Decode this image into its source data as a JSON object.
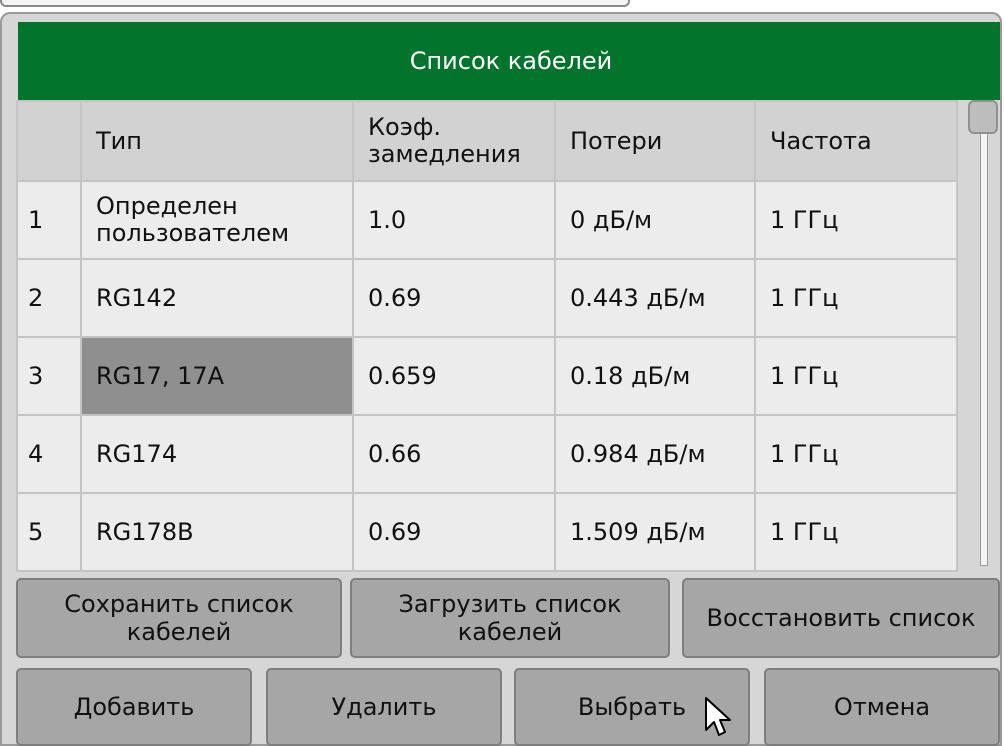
{
  "dialog": {
    "title": "Список кабелей"
  },
  "table": {
    "headers": [
      "",
      "Тип",
      "Коэф.\nзамедления",
      "Потери",
      "Частота"
    ],
    "rows": [
      {
        "n": "1",
        "type": "Определен\nпользователем",
        "vf": "1.0",
        "loss": "0 дБ/м",
        "freq": "1 ГГц"
      },
      {
        "n": "2",
        "type": "RG142",
        "vf": "0.69",
        "loss": "0.443 дБ/м",
        "freq": "1 ГГц"
      },
      {
        "n": "3",
        "type": "RG17, 17A",
        "vf": "0.659",
        "loss": "0.18 дБ/м",
        "freq": "1 ГГц"
      },
      {
        "n": "4",
        "type": "RG174",
        "vf": "0.66",
        "loss": "0.984 дБ/м",
        "freq": "1 ГГц"
      },
      {
        "n": "5",
        "type": "RG178B",
        "vf": "0.69",
        "loss": "1.509 дБ/м",
        "freq": "1 ГГц"
      }
    ],
    "selected_row": 3
  },
  "buttons": {
    "save_list": "Сохранить список\nкабелей",
    "load_list": "Загрузить список\nкабелей",
    "restore_list": "Восстановить список",
    "add": "Добавить",
    "delete": "Удалить",
    "select": "Выбрать",
    "cancel": "Отмена"
  },
  "colors": {
    "title_bg": "#02742b",
    "selected_cell": "#8f8f8f",
    "button_bg": "#a6a6a6"
  },
  "icons": {
    "cursor": "mouse-pointer-icon"
  }
}
